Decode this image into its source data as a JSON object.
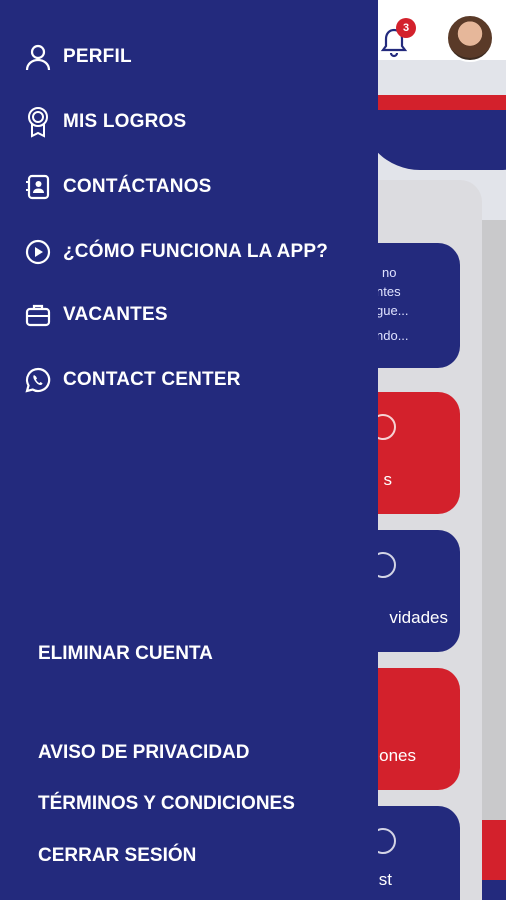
{
  "header": {
    "notification_count": "3"
  },
  "background": {
    "quote_lines": [
      "no",
      "ntes",
      "gue...",
      "ndo..."
    ],
    "cards": [
      "s",
      "vidades",
      "ones",
      "st"
    ]
  },
  "menu": {
    "items": [
      {
        "label": "PERFIL",
        "icon": "person-icon"
      },
      {
        "label": "MIS LOGROS",
        "icon": "medal-icon"
      },
      {
        "label": "CONTÁCTANOS",
        "icon": "contact-book-icon"
      },
      {
        "label": "¿CÓMO FUNCIONA LA APP?",
        "icon": "play-circle-icon"
      },
      {
        "label": "VACANTES",
        "icon": "briefcase-icon"
      },
      {
        "label": "CONTACT CENTER",
        "icon": "whatsapp-icon"
      }
    ],
    "delete_account": "ELIMINAR CUENTA",
    "privacy": "AVISO DE PRIVACIDAD",
    "terms": "TÉRMINOS Y CONDICIONES",
    "logout": "CERRAR SESIÓN"
  }
}
